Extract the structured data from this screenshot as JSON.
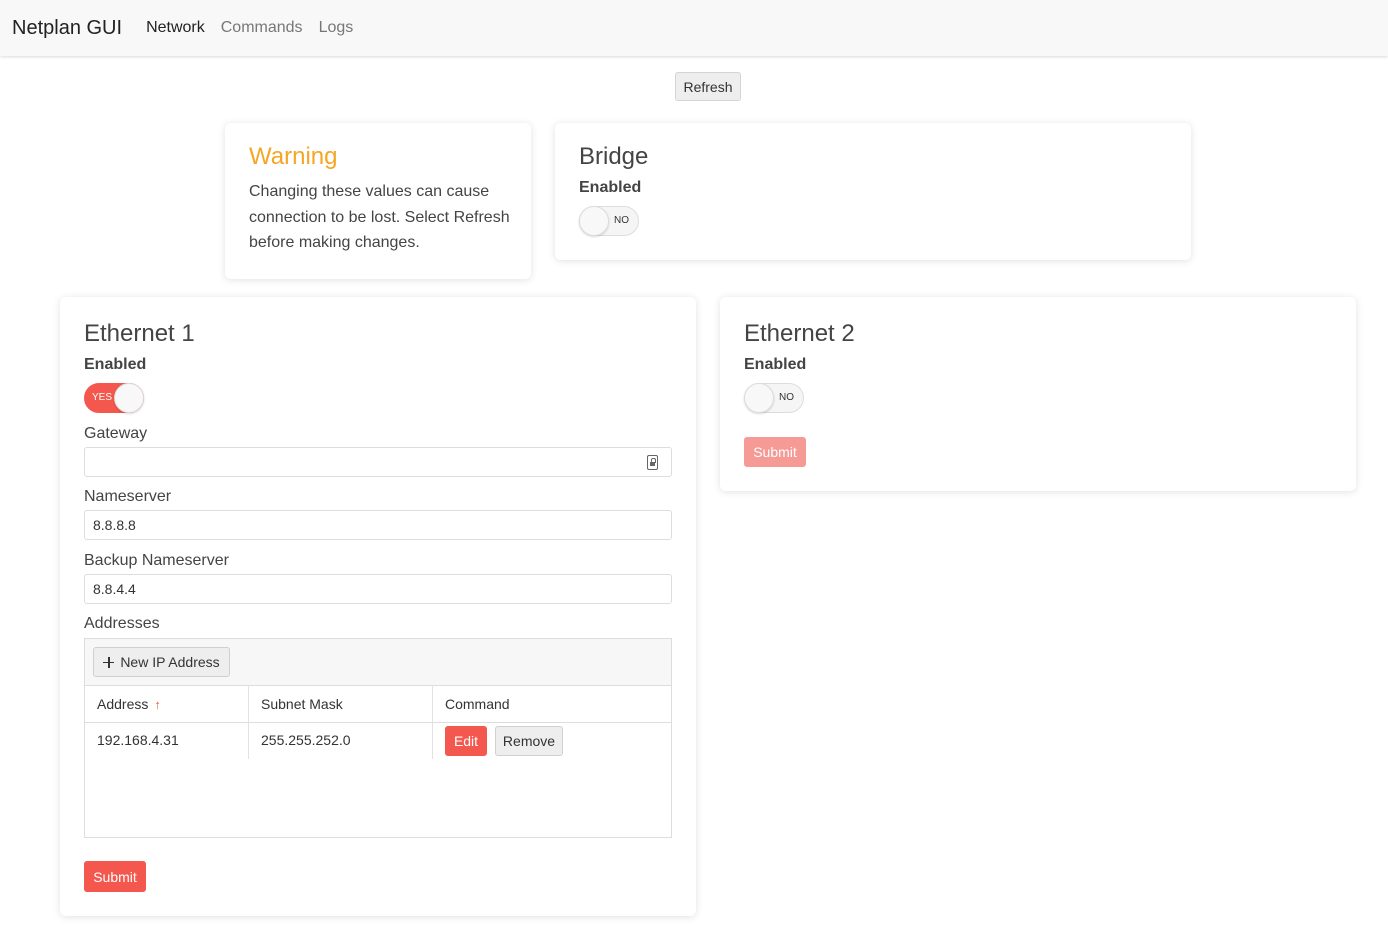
{
  "navbar": {
    "brand": "Netplan GUI",
    "links": [
      "Network",
      "Commands",
      "Logs"
    ]
  },
  "refresh_label": "Refresh",
  "warning": {
    "title": "Warning",
    "text": "Changing these values can cause connection to be lost. Select Refresh before making changes."
  },
  "bridge": {
    "title": "Bridge",
    "enabled_label": "Enabled",
    "toggle_text": "NO"
  },
  "ethernet1": {
    "title": "Ethernet 1",
    "enabled_label": "Enabled",
    "toggle_text": "YES",
    "gateway_label": "Gateway",
    "gateway_value": "",
    "nameserver_label": "Nameserver",
    "nameserver_value": "8.8.8.8",
    "backup_label": "Backup Nameserver",
    "backup_value": "8.8.4.4",
    "addresses_label": "Addresses",
    "new_ip_label": "New IP Address",
    "columns": [
      "Address",
      "Subnet Mask",
      "Command"
    ],
    "rows": [
      {
        "address": "192.168.4.31",
        "subnet": "255.255.252.0",
        "edit_label": "Edit",
        "remove_label": "Remove"
      }
    ],
    "submit_label": "Submit"
  },
  "ethernet2": {
    "title": "Ethernet 2",
    "enabled_label": "Enabled",
    "toggle_text": "NO",
    "submit_label": "Submit"
  },
  "colors": {
    "accent": "#f4574e",
    "warning": "#f5a623",
    "disabled_accent": "#f59a94"
  },
  "icons": {
    "gateway_input": "lock-icon",
    "new_ip": "plus-icon",
    "sort": "sort-ascending-icon"
  }
}
